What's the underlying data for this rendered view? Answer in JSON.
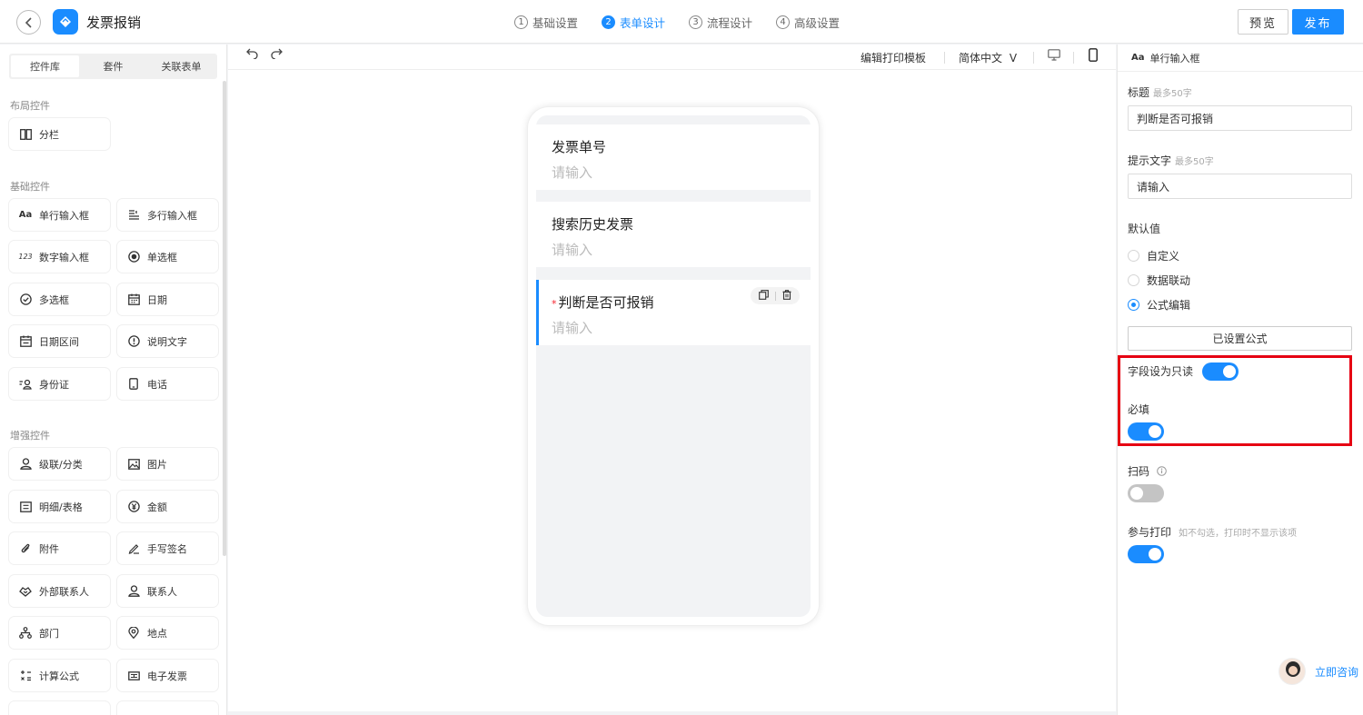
{
  "header": {
    "title": "发票报销",
    "steps": [
      {
        "num": "1",
        "label": "基础设置"
      },
      {
        "num": "2",
        "label": "表单设计"
      },
      {
        "num": "3",
        "label": "流程设计"
      },
      {
        "num": "4",
        "label": "高级设置"
      }
    ],
    "active_step": 2,
    "preview_label": "预览",
    "publish_label": "发布"
  },
  "left_panel": {
    "tabs": [
      "控件库",
      "套件",
      "关联表单"
    ],
    "active_tab": "控件库",
    "sections": {
      "layout": "布局控件",
      "basic": "基础控件",
      "enhanced": "增强控件"
    },
    "layout_controls": [
      {
        "icon": "columns-icon",
        "label": "分栏"
      }
    ],
    "basic_controls": [
      {
        "icon": "text-icon",
        "glyph": "Aa",
        "label": "单行输入框"
      },
      {
        "icon": "multiline-icon",
        "glyph": "",
        "label": "多行输入框"
      },
      {
        "icon": "number-icon",
        "glyph": "123",
        "label": "数字输入框"
      },
      {
        "icon": "radio-icon",
        "glyph": "",
        "label": "单选框"
      },
      {
        "icon": "checkbox-icon",
        "glyph": "",
        "label": "多选框"
      },
      {
        "icon": "calendar-icon",
        "glyph": "",
        "label": "日期"
      },
      {
        "icon": "date-range-icon",
        "glyph": "",
        "label": "日期区间"
      },
      {
        "icon": "info-icon",
        "glyph": "",
        "label": "说明文字"
      },
      {
        "icon": "id-card-icon",
        "glyph": "",
        "label": "身份证"
      },
      {
        "icon": "phone-icon",
        "glyph": "",
        "label": "电话"
      }
    ],
    "enhanced_controls": [
      {
        "icon": "cascade-icon",
        "label": "级联/分类"
      },
      {
        "icon": "image-icon",
        "label": "图片"
      },
      {
        "icon": "table-icon",
        "label": "明细/表格"
      },
      {
        "icon": "money-icon",
        "label": "金额"
      },
      {
        "icon": "attachment-icon",
        "label": "附件"
      },
      {
        "icon": "signature-icon",
        "label": "手写签名"
      },
      {
        "icon": "handshake-icon",
        "label": "外部联系人"
      },
      {
        "icon": "contact-icon",
        "label": "联系人"
      },
      {
        "icon": "department-icon",
        "label": "部门"
      },
      {
        "icon": "location-icon",
        "label": "地点"
      },
      {
        "icon": "formula-icon",
        "label": "计算公式"
      },
      {
        "icon": "invoice-icon",
        "label": "电子发票"
      }
    ]
  },
  "toolbar": {
    "print_template": "编辑打印模板",
    "language": "简体中文",
    "language_caret": "V"
  },
  "form_fields": [
    {
      "label": "发票单号",
      "placeholder": "请输入",
      "required": false,
      "selected": false
    },
    {
      "label": "搜索历史发票",
      "placeholder": "请输入",
      "required": false,
      "selected": false
    },
    {
      "label": "判断是否可报销",
      "placeholder": "请输入",
      "required": true,
      "selected": true
    }
  ],
  "required_star": "*",
  "right_panel": {
    "header_glyph": "Aa",
    "header": "单行输入框",
    "title_label": "标题",
    "title_hint": "最多50字",
    "title_value": "判断是否可报销",
    "placeholder_label": "提示文字",
    "placeholder_hint": "最多50字",
    "placeholder_value": "请输入",
    "default_label": "默认值",
    "default_options": [
      "自定义",
      "数据联动",
      "公式编辑"
    ],
    "default_selected": "公式编辑",
    "formula_button": "已设置公式",
    "readonly_label": "字段设为只读",
    "readonly_on": true,
    "required_label": "必填",
    "required_on": true,
    "scan_label": "扫码",
    "scan_on": false,
    "print_label": "参与打印",
    "print_hint": "如不勾选，打印时不显示该项",
    "print_on": true
  },
  "consult": {
    "label": "立即咨询"
  },
  "colors": {
    "accent": "#1a8cff",
    "highlight": "#e60012",
    "required": "#f5222d"
  }
}
